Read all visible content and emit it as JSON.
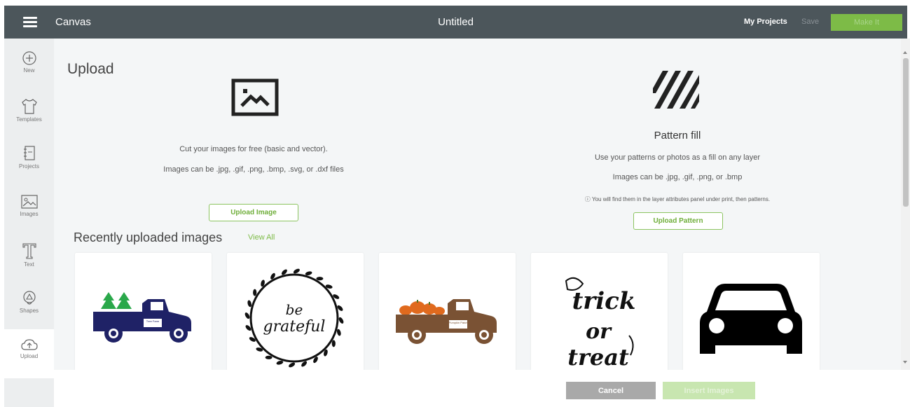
{
  "header": {
    "app_title": "Canvas",
    "doc_title": "Untitled",
    "my_projects": "My Projects",
    "save": "Save",
    "make_it": "Make It"
  },
  "sidebar": {
    "items": [
      {
        "label": "New",
        "icon": "plus-circle-icon"
      },
      {
        "label": "Templates",
        "icon": "shirt-icon"
      },
      {
        "label": "Projects",
        "icon": "projects-icon"
      },
      {
        "label": "Images",
        "icon": "image-icon"
      },
      {
        "label": "Text",
        "icon": "text-icon"
      },
      {
        "label": "Shapes",
        "icon": "shapes-icon"
      },
      {
        "label": "Upload",
        "icon": "upload-cloud-icon",
        "active": true
      }
    ]
  },
  "upload": {
    "heading": "Upload",
    "desc_line1": "Cut your images for free (basic and vector).",
    "desc_line2": "Images can be .jpg, .gif, .png, .bmp, .svg, or .dxf files",
    "button": "Upload Image"
  },
  "pattern": {
    "title": "Pattern fill",
    "desc_line1": "Use your patterns or photos as a fill on any layer",
    "desc_line2": "Images can be .jpg, .gif, .png, or .bmp",
    "info": "ⓘ You will find them in the layer attributes panel under print, then patterns.",
    "button": "Upload Pattern"
  },
  "recent": {
    "title": "Recently uploaded images",
    "view_all": "View All",
    "images": [
      {
        "name": "tree-farm-truck",
        "text": "Tree Farm"
      },
      {
        "name": "be-grateful-wreath",
        "text": "be grateful"
      },
      {
        "name": "pumpkin-patch-truck",
        "text": "Pumpkin Patch"
      },
      {
        "name": "trick-or-treat",
        "text": "trick or treat"
      },
      {
        "name": "car-silhouette",
        "text": ""
      }
    ]
  },
  "footer": {
    "cancel": "Cancel",
    "insert": "Insert Images"
  },
  "colors": {
    "topbar": "#4c565b",
    "accent_green": "#7dbb47",
    "sidebar": "#eceeef",
    "main_bg": "#f4f6f7",
    "truck_navy": "#1f2266",
    "tree_green": "#2aa84a",
    "truck_brown": "#7a5234",
    "pumpkin_orange": "#e06a1e"
  }
}
